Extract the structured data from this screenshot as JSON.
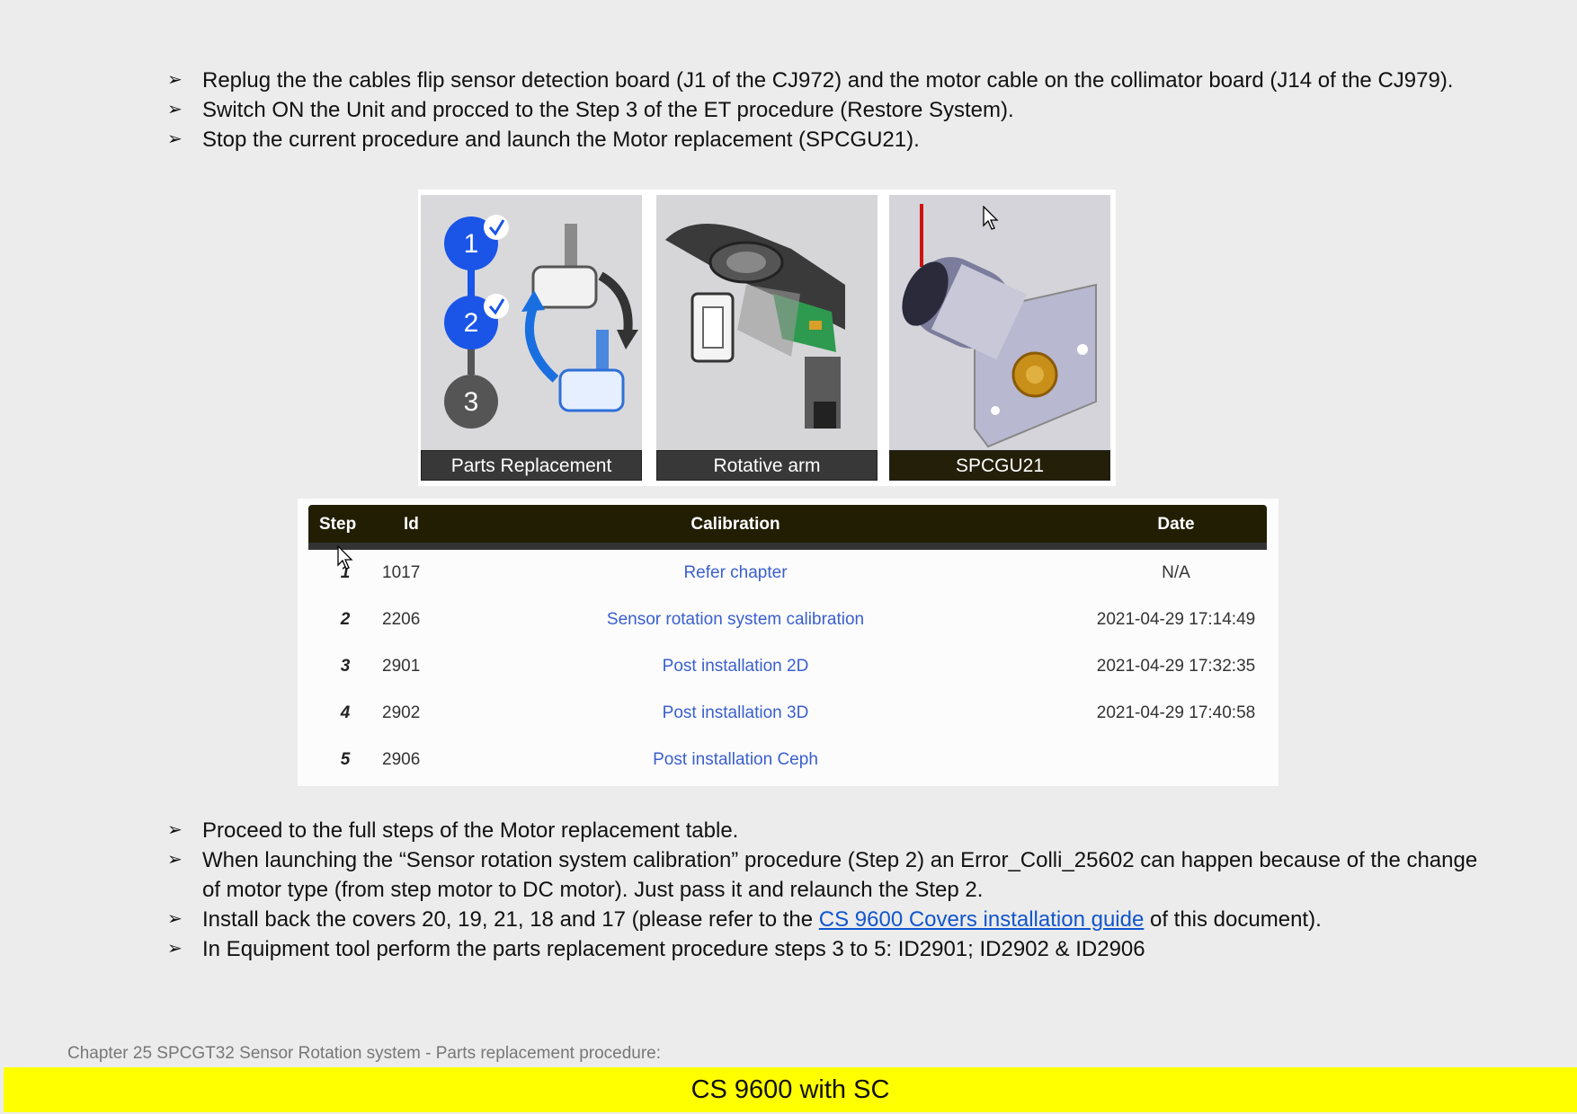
{
  "top_bullets": [
    "Replug the the cables flip sensor detection board (J1 of the CJ972) and the motor cable on the collimator board (J14 of the CJ979).",
    "Switch ON the Unit and procced to the Step 3 of the ET procedure (Restore System).",
    "Stop the current procedure and launch the Motor replacement (SPCGU21)."
  ],
  "figure": {
    "panels": [
      {
        "caption": "Parts Replacement",
        "steps": [
          "1",
          "2",
          "3"
        ],
        "icon": "parts-replacement-steps"
      },
      {
        "caption": "Rotative arm",
        "icon": "rotative-arm-photo"
      },
      {
        "caption": "SPCGU21",
        "icon": "dc-motor-photo"
      }
    ]
  },
  "calibration_table": {
    "headers": {
      "step": "Step",
      "id": "Id",
      "calibration": "Calibration",
      "date": "Date"
    },
    "rows": [
      {
        "step": "1",
        "id": "1017",
        "calibration": "Refer chapter",
        "date": "N/A"
      },
      {
        "step": "2",
        "id": "2206",
        "calibration": "Sensor rotation system calibration",
        "date": "2021-04-29 17:14:49"
      },
      {
        "step": "3",
        "id": "2901",
        "calibration": "Post installation 2D",
        "date": "2021-04-29 17:32:35"
      },
      {
        "step": "4",
        "id": "2902",
        "calibration": "Post installation 3D",
        "date": "2021-04-29 17:40:58"
      },
      {
        "step": "5",
        "id": "2906",
        "calibration": "Post installation Ceph",
        "date": ""
      }
    ]
  },
  "bottom_bullets": {
    "b1": "Proceed to the full steps of the Motor replacement table.",
    "b2": "When launching the “Sensor rotation system calibration” procedure (Step 2) an Error_Colli_25602 can happen because of the change of motor type (from step motor to DC motor). Just pass it and relaunch the Step 2.",
    "b3_before": "Install back the covers 20, 19, 21, 18 and 17 (please refer to the ",
    "b3_link": "CS 9600 Covers installation guide",
    "b3_after": " of this document).",
    "b4": "In Equipment tool perform the parts replacement procedure steps 3 to 5: ID2901; ID2902 & ID2906"
  },
  "footer": {
    "chapter": "Chapter 25 SPCGT32 Sensor Rotation system - Parts replacement procedure:",
    "product": "CS 9600 with SC"
  },
  "colors": {
    "footer_bar": "#ffff00",
    "table_header": "#221e04",
    "link": "#1155cc",
    "step_blue": "#1a55e8"
  }
}
